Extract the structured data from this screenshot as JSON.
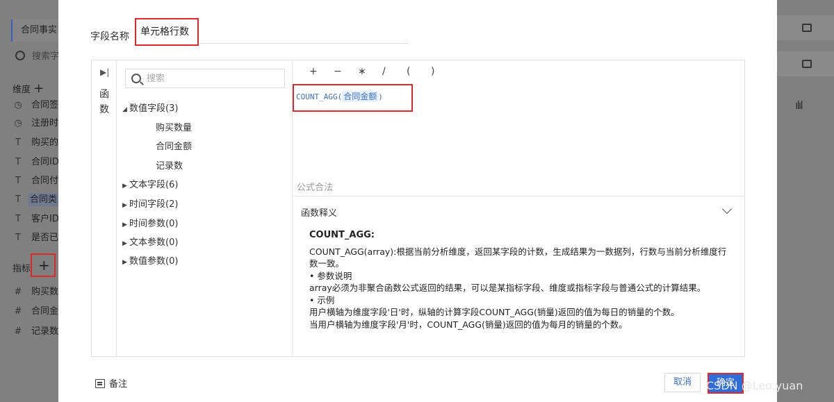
{
  "background": {
    "dataset_label": "合同事实",
    "search_placeholder": "搜索字",
    "dimension_label": "维度",
    "dimension_items": [
      {
        "icon": "clock-icon",
        "glyph": "◷",
        "label": "合同签"
      },
      {
        "icon": "clock-icon",
        "glyph": "◷",
        "label": "注册时"
      },
      {
        "icon": "text-field-icon",
        "glyph": "T",
        "label": "购买的"
      },
      {
        "icon": "text-field-icon",
        "glyph": "T",
        "label": "合同ID"
      },
      {
        "icon": "text-field-icon",
        "glyph": "T",
        "label": "合同付"
      },
      {
        "icon": "text-field-icon",
        "glyph": "T",
        "label": "合同类"
      },
      {
        "icon": "text-field-icon",
        "glyph": "T",
        "label": "客户ID"
      },
      {
        "icon": "text-field-icon",
        "glyph": "T",
        "label": "是否已"
      }
    ],
    "metric_label": "指标",
    "metric_items": [
      {
        "icon": "number-field-icon",
        "glyph": "#",
        "label": "购买数"
      },
      {
        "icon": "number-field-icon",
        "glyph": "#",
        "label": "合同金"
      },
      {
        "icon": "number-field-icon",
        "glyph": "#",
        "label": "记录数"
      }
    ],
    "plus_glyph": "+"
  },
  "dialog": {
    "field_name_label": "字段名称",
    "field_name_value": "单元格行数",
    "tab_label": "函数",
    "search_placeholder": "搜索",
    "tree": {
      "numeric_group": "数值字段(3)",
      "numeric_fields": [
        "购买数量",
        "合同金额",
        "记录数"
      ],
      "collapsed_groups": [
        "文本字段(6)",
        "时间字段(2)",
        "时间参数(0)",
        "文本参数(0)",
        "数值参数(0)"
      ]
    },
    "operators": [
      "+",
      "−",
      "∗",
      "/",
      "(",
      ")"
    ],
    "formula_func": "COUNT_AGG(",
    "formula_arg": "合同金额",
    "formula_close": ")",
    "syntax_status": "公式合法",
    "help_title": "函数释义",
    "help": {
      "name": "COUNT_AGG:",
      "description": "COUNT_AGG(array):根据当前分析维度，返回某字段的计数，生成结果为一数据列，行数与当前分析维度行数一致。",
      "param_header": "• 参数说明",
      "param_text": "array必须为非聚合函数公式返回的结果，可以是某指标字段、维度或指标字段与普通公式的计算结果。",
      "example_header": "• 示例",
      "example_1": "用户横轴为维度字段'日'时，纵轴的计算字段COUNT_AGG(销量)返回的值为每日的销量的个数。",
      "example_2": "当用户横轴为维度字段'月'时，COUNT_AGG(销量)返回的值为每月的销量的个数。"
    },
    "note_label": "备注",
    "cancel_label": "取消",
    "confirm_label": "确定"
  },
  "watermark": "CSDN @Leo.yuan"
}
